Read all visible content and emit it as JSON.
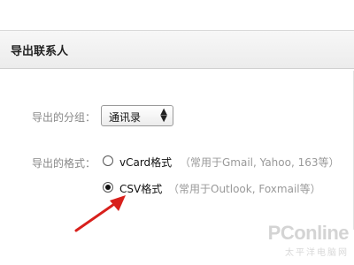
{
  "header": {
    "title": "导出联系人"
  },
  "form": {
    "group_label": "导出的分组：",
    "group_select": {
      "value": "通讯录",
      "arrow": "▲▼"
    },
    "format_label": "导出的格式：",
    "options": [
      {
        "name": "vCard格式",
        "desc": "（常用于Gmail, Yahoo, 163等）",
        "checked": false
      },
      {
        "name": "CSV格式",
        "desc": "（常用于Outlook, Foxmail等）",
        "checked": true
      }
    ]
  },
  "annotation": {
    "arrow_color": "#d8201c"
  },
  "watermark": {
    "logo": "PConline",
    "sub": "太平洋电脑网"
  }
}
